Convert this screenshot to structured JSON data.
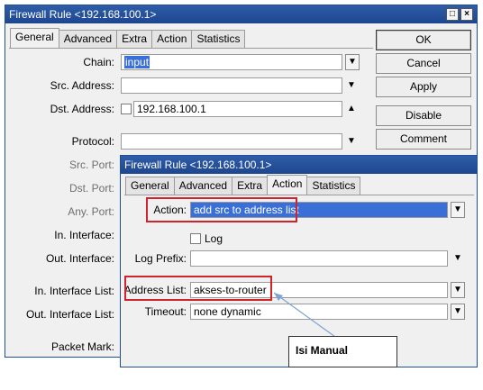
{
  "back_window": {
    "title": "Firewall Rule <192.168.100.1>",
    "tabs": [
      "General",
      "Advanced",
      "Extra",
      "Action",
      "Statistics"
    ],
    "active_tab": "General",
    "fields": {
      "chain_label": "Chain:",
      "chain_value": "input",
      "src_address_label": "Src. Address:",
      "dst_address_label": "Dst. Address:",
      "dst_address_value": "192.168.100.1",
      "protocol_label": "Protocol:",
      "src_port_label": "Src. Port:",
      "dst_port_label": "Dst. Port:",
      "any_port_label": "Any. Port:",
      "in_interface_label": "In. Interface:",
      "out_interface_label": "Out. Interface:",
      "in_interface_list_label": "In. Interface List:",
      "out_interface_list_label": "Out. Interface List:",
      "packet_mark_label": "Packet Mark:"
    },
    "buttons": {
      "ok": "OK",
      "cancel": "Cancel",
      "apply": "Apply",
      "disable": "Disable",
      "comment": "Comment"
    }
  },
  "front_window": {
    "title": "Firewall Rule <192.168.100.1>",
    "tabs": [
      "General",
      "Advanced",
      "Extra",
      "Action",
      "Statistics"
    ],
    "active_tab": "Action",
    "fields": {
      "action_label": "Action:",
      "action_value": "add src to address list",
      "log_label": "Log",
      "log_prefix_label": "Log Prefix:",
      "address_list_label": "Address List:",
      "address_list_value": "akses-to-router",
      "timeout_label": "Timeout:",
      "timeout_value": "none dynamic"
    }
  },
  "annotation": {
    "callout_text": "Isi Manual",
    "highlight_color": "#d0232b",
    "arrow_color": "#7fa3d3"
  },
  "colors": {
    "titlebar": "#1d4690",
    "selection": "#3a6fd8"
  }
}
